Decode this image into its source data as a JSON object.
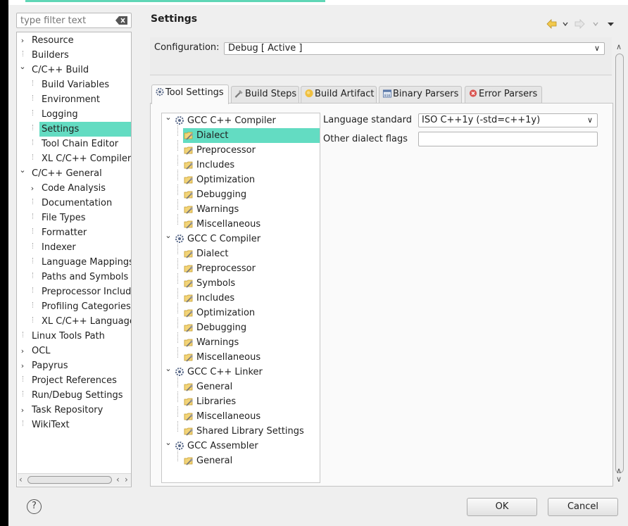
{
  "filter": {
    "placeholder": "type filter text"
  },
  "left_tree": [
    {
      "label": "Resource",
      "depth": 0,
      "twisty": "collapsed"
    },
    {
      "label": "Builders",
      "depth": 0,
      "twisty": "none"
    },
    {
      "label": "C/C++ Build",
      "depth": 0,
      "twisty": "expanded"
    },
    {
      "label": "Build Variables",
      "depth": 1,
      "twisty": "none"
    },
    {
      "label": "Environment",
      "depth": 1,
      "twisty": "none"
    },
    {
      "label": "Logging",
      "depth": 1,
      "twisty": "none"
    },
    {
      "label": "Settings",
      "depth": 1,
      "twisty": "none",
      "selected": true
    },
    {
      "label": "Tool Chain Editor",
      "depth": 1,
      "twisty": "none"
    },
    {
      "label": "XL C/C++ Compiler",
      "depth": 1,
      "twisty": "none"
    },
    {
      "label": "C/C++ General",
      "depth": 0,
      "twisty": "expanded"
    },
    {
      "label": "Code Analysis",
      "depth": 1,
      "twisty": "collapsed"
    },
    {
      "label": "Documentation",
      "depth": 1,
      "twisty": "none"
    },
    {
      "label": "File Types",
      "depth": 1,
      "twisty": "none"
    },
    {
      "label": "Formatter",
      "depth": 1,
      "twisty": "none"
    },
    {
      "label": "Indexer",
      "depth": 1,
      "twisty": "none"
    },
    {
      "label": "Language Mappings",
      "depth": 1,
      "twisty": "none"
    },
    {
      "label": "Paths and Symbols",
      "depth": 1,
      "twisty": "none"
    },
    {
      "label": "Preprocessor Includ",
      "depth": 1,
      "twisty": "none"
    },
    {
      "label": "Profiling Categories",
      "depth": 1,
      "twisty": "none"
    },
    {
      "label": "XL C/C++ Language",
      "depth": 1,
      "twisty": "none"
    },
    {
      "label": "Linux Tools Path",
      "depth": 0,
      "twisty": "none"
    },
    {
      "label": "OCL",
      "depth": 0,
      "twisty": "collapsed"
    },
    {
      "label": "Papyrus",
      "depth": 0,
      "twisty": "collapsed"
    },
    {
      "label": "Project References",
      "depth": 0,
      "twisty": "none"
    },
    {
      "label": "Run/Debug Settings",
      "depth": 0,
      "twisty": "none"
    },
    {
      "label": "Task Repository",
      "depth": 0,
      "twisty": "collapsed"
    },
    {
      "label": "WikiText",
      "depth": 0,
      "twisty": "none"
    }
  ],
  "header": {
    "title": "Settings"
  },
  "configuration": {
    "label": "Configuration:",
    "value": "Debug  [ Active ]"
  },
  "tabs": [
    {
      "label": "Tool Settings",
      "icon": "gear-tool-icon",
      "active": true
    },
    {
      "label": "Build Steps",
      "icon": "build-steps-icon"
    },
    {
      "label": "Build Artifact",
      "icon": "artifact-icon"
    },
    {
      "label": "Binary Parsers",
      "icon": "binary-icon"
    },
    {
      "label": "Error Parsers",
      "icon": "error-icon"
    }
  ],
  "tool_tree": [
    {
      "label": "GCC C++ Compiler",
      "type": "tool"
    },
    {
      "label": "Dialect",
      "type": "option",
      "selected": true
    },
    {
      "label": "Preprocessor",
      "type": "option"
    },
    {
      "label": "Includes",
      "type": "option"
    },
    {
      "label": "Optimization",
      "type": "option"
    },
    {
      "label": "Debugging",
      "type": "option"
    },
    {
      "label": "Warnings",
      "type": "option"
    },
    {
      "label": "Miscellaneous",
      "type": "option"
    },
    {
      "label": "GCC C Compiler",
      "type": "tool"
    },
    {
      "label": "Dialect",
      "type": "option"
    },
    {
      "label": "Preprocessor",
      "type": "option"
    },
    {
      "label": "Symbols",
      "type": "option"
    },
    {
      "label": "Includes",
      "type": "option"
    },
    {
      "label": "Optimization",
      "type": "option"
    },
    {
      "label": "Debugging",
      "type": "option"
    },
    {
      "label": "Warnings",
      "type": "option"
    },
    {
      "label": "Miscellaneous",
      "type": "option"
    },
    {
      "label": "GCC C++ Linker",
      "type": "tool"
    },
    {
      "label": "General",
      "type": "option"
    },
    {
      "label": "Libraries",
      "type": "option"
    },
    {
      "label": "Miscellaneous",
      "type": "option"
    },
    {
      "label": "Shared Library Settings",
      "type": "option"
    },
    {
      "label": "GCC Assembler",
      "type": "tool"
    },
    {
      "label": "General",
      "type": "option"
    }
  ],
  "options": {
    "language_standard_label": "Language standard",
    "language_standard_value": "ISO C++1y (-std=c++1y)",
    "other_flags_label": "Other dialect flags",
    "other_flags_value": ""
  },
  "buttons": {
    "ok": "OK",
    "cancel": "Cancel",
    "help": "?"
  },
  "colors": {
    "selection": "#63dcc2",
    "background": "#efefef"
  }
}
